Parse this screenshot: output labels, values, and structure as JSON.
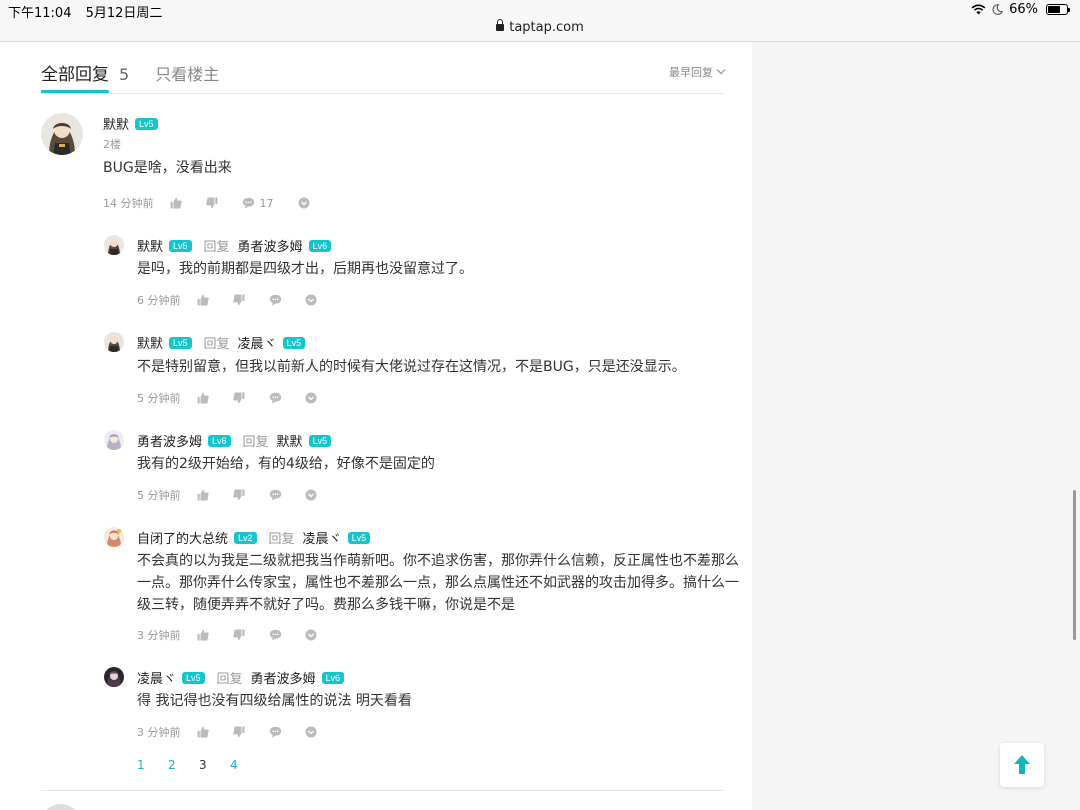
{
  "status_bar": {
    "time": "下午11:04",
    "date": "5月12日周二",
    "url": "taptap.com",
    "battery": "66%",
    "battery_level": 0.66
  },
  "header": {
    "tab_all_label": "全部回复",
    "tab_all_count": "5",
    "tab_op_label": "只看楼主",
    "sort_label": "最早回复"
  },
  "main_comment": {
    "author": "默默",
    "level": "Lv5",
    "floor": "2楼",
    "text": "BUG是啥，没看出来",
    "time": "14 分钟前",
    "comment_count": "17"
  },
  "reply_word": "回复",
  "replies": [
    {
      "author": "默默",
      "level": "Lv5",
      "to": "勇者波多姆",
      "to_level": "Lv6",
      "text": "是吗，我的前期都是四级才出，后期再也没留意过了。",
      "time": "6 分钟前"
    },
    {
      "author": "默默",
      "level": "Lv5",
      "to": "凌晨ヾ",
      "to_level": "Lv5",
      "text": "不是特别留意，但我以前新人的时候有大佬说过存在这情况，不是BUG，只是还没显示。",
      "time": "5 分钟前"
    },
    {
      "author": "勇者波多姆",
      "level": "Lv6",
      "to": "默默",
      "to_level": "Lv5",
      "text": "我有的2级开始给，有的4级给，好像不是固定的",
      "time": "5 分钟前"
    },
    {
      "author": "自闭了的大总统",
      "level": "Lv2",
      "to": "凌晨ヾ",
      "to_level": "Lv5",
      "text_lines": [
        "不会真的以为我是二级就把我当作萌新吧。你不追求伤害，那你弄什么信赖，反正属性也不差那么",
        "一点。那你弄什么传家宝，属性也不差那么一点，那么点属性还不如武器的攻击加得多。搞什么一",
        "级三转，随便弄弄不就好了吗。费那么多钱干嘛，你说是不是"
      ],
      "time": "3 分钟前"
    },
    {
      "author": "凌晨ヾ",
      "level": "Lv5",
      "to": "勇者波多姆",
      "to_level": "Lv6",
      "text": "得 我记得也没有四级给属性的说法 明天看看",
      "time": "3 分钟前"
    }
  ],
  "pagination": {
    "pages": [
      "1",
      "2",
      "3",
      "4"
    ],
    "current": "3"
  },
  "colors": {
    "accent": "#15c5ce",
    "link": "#15b5be"
  }
}
